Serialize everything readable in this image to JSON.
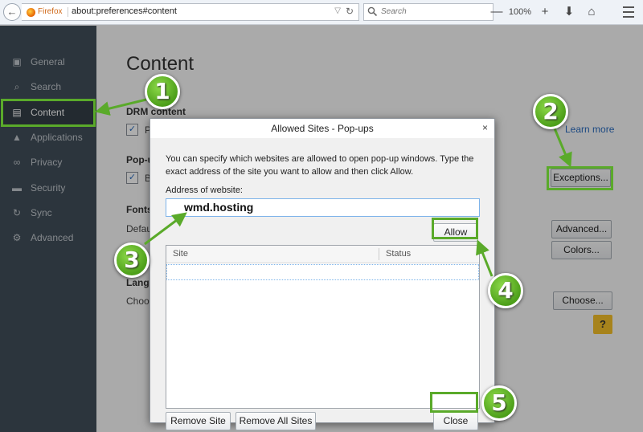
{
  "browser": {
    "brand": "Firefox",
    "url": "about:preferences#content",
    "search_placeholder": "Search",
    "zoom": "100%",
    "zoom_out": "—",
    "zoom_in": "+"
  },
  "sidebar": {
    "items": [
      {
        "label": "General",
        "icon": "general-icon",
        "glyph": "▣"
      },
      {
        "label": "Search",
        "icon": "search-icon",
        "glyph": "⌕"
      },
      {
        "label": "Content",
        "icon": "content-icon",
        "glyph": "▤"
      },
      {
        "label": "Applications",
        "icon": "applications-icon",
        "glyph": "▲"
      },
      {
        "label": "Privacy",
        "icon": "privacy-mask-icon",
        "glyph": "∞"
      },
      {
        "label": "Security",
        "icon": "lock-icon",
        "glyph": "▬"
      },
      {
        "label": "Sync",
        "icon": "sync-icon",
        "glyph": "↻"
      },
      {
        "label": "Advanced",
        "icon": "wizard-hat-icon",
        "glyph": "⚙"
      }
    ],
    "active": "Content"
  },
  "main": {
    "title": "Content",
    "drm_heading": "DRM content",
    "drm_checkbox_text": "P",
    "popups_heading": "Pop-u",
    "popups_checkbox_text": "B",
    "learn_more": "Learn more",
    "exceptions_button": "Exceptions...",
    "fonts_heading": "Fonts",
    "fonts_default": "Defau",
    "advanced_button": "Advanced...",
    "colors_button": "Colors...",
    "languages_heading": "Langu",
    "languages_text": "Choos",
    "choose_button": "Choose...",
    "help_button": "?"
  },
  "dialog": {
    "title": "Allowed Sites - Pop-ups",
    "close_glyph": "×",
    "description": "You can specify which websites are allowed to open pop-up windows. Type the exact address of the site you want to allow and then click Allow.",
    "address_label": "Address of website:",
    "address_value": "wmd.hosting",
    "allow_button": "Allow",
    "columns": [
      "Site",
      "Status"
    ],
    "remove_site_button": "Remove Site",
    "remove_all_button": "Remove All Sites",
    "close_button": "Close"
  },
  "annotations": {
    "color": "#5aaa2a",
    "steps": [
      "1",
      "2",
      "3",
      "4",
      "5"
    ]
  }
}
